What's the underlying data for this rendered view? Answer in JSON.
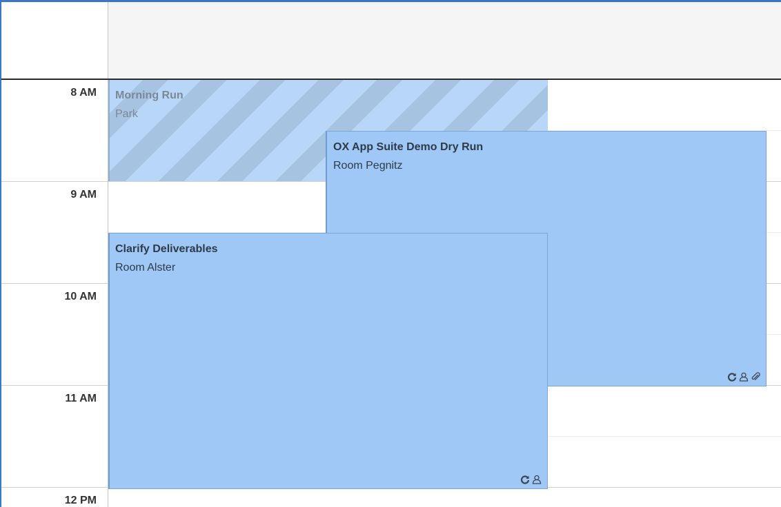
{
  "time_labels": [
    "8 AM",
    "9 AM",
    "10 AM",
    "11 AM",
    "12 PM"
  ],
  "events": [
    {
      "title": "Morning Run",
      "location": "Park",
      "status": "tentative",
      "icons": []
    },
    {
      "title": "OX App Suite Demo Dry Run",
      "location": "Room Pegnitz",
      "status": "confirmed",
      "icons": [
        "recurrence-icon",
        "participants-icon",
        "attachment-icon"
      ]
    },
    {
      "title": "Clarify Deliverables",
      "location": "Room Alster",
      "status": "confirmed",
      "icons": [
        "recurrence-icon",
        "participants-icon"
      ]
    }
  ],
  "colors": {
    "event_fill": "#9fc8f6",
    "event_border": "#7ea6d2",
    "tentative_stripe_light": "#b8d7f8",
    "tentative_stripe_dark": "#a7c3e2",
    "window_border": "#3a78c7"
  }
}
